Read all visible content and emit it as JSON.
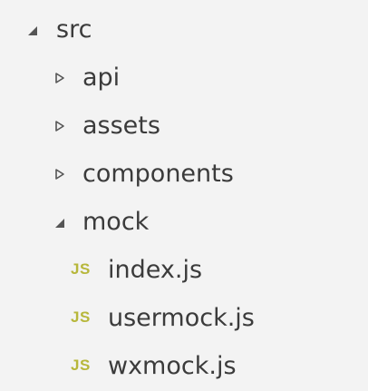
{
  "explorer": {
    "root": {
      "label": "src",
      "expanded": true
    },
    "folders": {
      "api": {
        "label": "api",
        "expanded": false
      },
      "assets": {
        "label": "assets",
        "expanded": false
      },
      "components": {
        "label": "components",
        "expanded": false
      },
      "mock": {
        "label": "mock",
        "expanded": true
      }
    },
    "files": [
      {
        "label": "index.js",
        "icon": "js-file-icon",
        "badge": "JS"
      },
      {
        "label": "usermock.js",
        "icon": "js-file-icon",
        "badge": "JS"
      },
      {
        "label": "wxmock.js",
        "icon": "js-file-icon",
        "badge": "JS"
      }
    ]
  },
  "colors": {
    "background": "#f3f3f3",
    "text": "#3b3b3b",
    "twisty": "#555555",
    "js_icon": "#b7b73b"
  }
}
